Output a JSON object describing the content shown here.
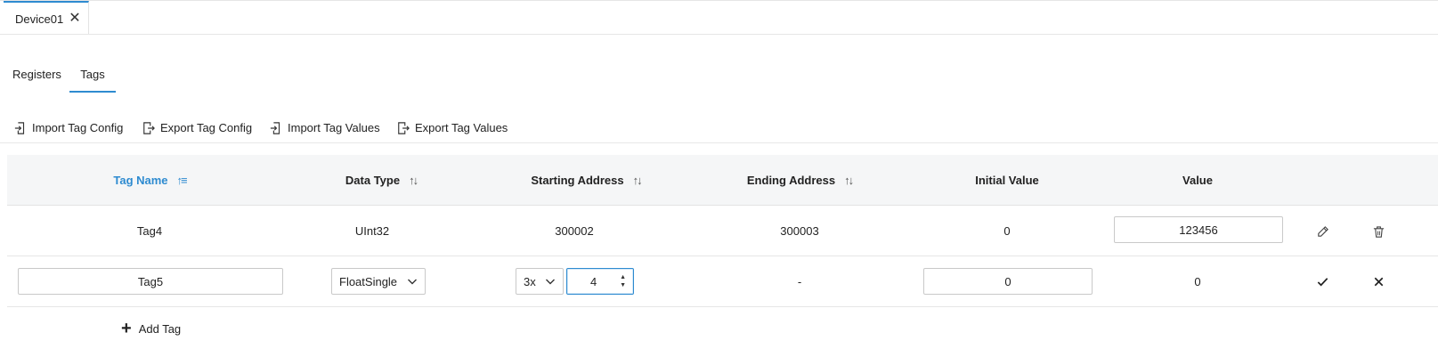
{
  "document_tab": {
    "title": "Device01"
  },
  "subtabs": [
    {
      "label": "Registers"
    },
    {
      "label": "Tags"
    }
  ],
  "toolbar": {
    "import_tag_config": "Import Tag Config",
    "export_tag_config": "Export Tag Config",
    "import_tag_values": "Import Tag Values",
    "export_tag_values": "Export Tag Values"
  },
  "table": {
    "columns": [
      {
        "label": "Tag Name"
      },
      {
        "label": "Data Type"
      },
      {
        "label": "Starting Address"
      },
      {
        "label": "Ending Address"
      },
      {
        "label": "Initial Value"
      },
      {
        "label": "Value"
      }
    ],
    "rows": [
      {
        "tag_name": "Tag4",
        "data_type": "UInt32",
        "starting_address": "300002",
        "ending_address": "300003",
        "initial_value": "0",
        "value": "123456"
      }
    ],
    "edit_row": {
      "tag_name": "Tag5",
      "data_type": "FloatSingle",
      "address_prefix": "3x",
      "address_offset": "4",
      "ending_address": "-",
      "initial_value": "0",
      "value": "0"
    }
  },
  "add_tag_label": "Add Tag",
  "icons": {
    "close": "close-icon",
    "sort": "sort-icon",
    "import": "import-icon",
    "export": "export-icon",
    "edit": "pencil-icon",
    "delete": "trash-icon",
    "confirm": "check-icon",
    "cancel": "x-icon",
    "add": "plus-icon"
  },
  "colors": {
    "accent": "#2e8bd0",
    "header_bg": "#f5f6f7"
  }
}
